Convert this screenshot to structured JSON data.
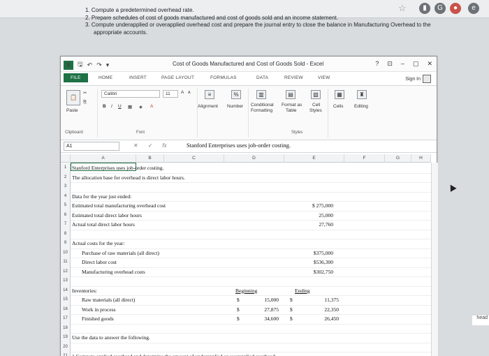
{
  "instructions": [
    "1. Compute a predetermined overhead rate.",
    "2. Prepare schedules of cost of goods manufactured and cost of goods sold and an income statement.",
    "3. Compute underapplied or overapplied overhead cost and prepare the journal entry to close the balance in Manufacturing Overhead to the",
    "appropriate accounts."
  ],
  "window": {
    "title": "Cost of Goods Manufactured and Cost of Goods Sold - Excel",
    "controls": [
      "?",
      "⊡",
      "–",
      "▢",
      "✕"
    ]
  },
  "tabs": [
    "FILE",
    "HOME",
    "INSERT",
    "PAGE LAYOUT",
    "FORMULAS",
    "DATA",
    "REVIEW",
    "VIEW"
  ],
  "sign_in": "Sign In",
  "ribbon": {
    "paste": "Paste",
    "font_name": "Calibri",
    "font_size": "11",
    "grow": "A",
    "shrink": "A",
    "bold": "B",
    "italic": "I",
    "underline": "U",
    "alignment": "Alignment",
    "number": "Number",
    "percent": "%",
    "conditional": "Conditional",
    "formatting": "Formatting",
    "format_as": "Format as",
    "table": "Table",
    "cell": "Cell",
    "styles_btn": "Styles",
    "cells": "Cells",
    "editing": "Editing",
    "group_clipboard": "Clipboard",
    "group_font": "Font",
    "group_styles": "Styles"
  },
  "formula_bar": {
    "name_box": "A1",
    "fx": "fx",
    "content": "Stanford Enterprises uses job-order costing."
  },
  "columns": [
    "A",
    "B",
    "C",
    "D",
    "E",
    "F",
    "G",
    "H"
  ],
  "rows": [
    {
      "n": "1",
      "a": "Stanford Enterprises uses job-order costing."
    },
    {
      "n": "2",
      "a": "The allocation base for overhead is direct labor hours."
    },
    {
      "n": "3",
      "a": ""
    },
    {
      "n": "4",
      "a": "Data for the year just ended:"
    },
    {
      "n": "5",
      "a": "Estimated total manufacturing overhead cost",
      "e": "$  275,000"
    },
    {
      "n": "6",
      "a": "Estimated total direct labor hours",
      "e": "25,000"
    },
    {
      "n": "7",
      "a": "Actual total direct labor hours",
      "e": "27,760"
    },
    {
      "n": "8",
      "a": ""
    },
    {
      "n": "9",
      "a": "Actual costs for the year:"
    },
    {
      "n": "10",
      "b": "Purchase of raw materials (all direct)",
      "e": "$375,000"
    },
    {
      "n": "11",
      "b": "Direct labor cost",
      "e": "$536,300"
    },
    {
      "n": "12",
      "b": "Manufacturing overhead costs",
      "e": "$302,750"
    },
    {
      "n": "13",
      "a": ""
    },
    {
      "n": "14",
      "a": "Inventories:",
      "d": "Beginning",
      "f": "Ending"
    },
    {
      "n": "15",
      "b": "Raw materials (all direct)",
      "ds": "$",
      "dv": "15,000",
      "es": "$",
      "ev": "11,375"
    },
    {
      "n": "16",
      "b": "Work in process",
      "ds": "$",
      "dv": "27,875",
      "es": "$",
      "ev": "22,350"
    },
    {
      "n": "17",
      "b": "Finished goods",
      "ds": "$",
      "dv": "34,600",
      "es": "$",
      "ev": "26,450"
    },
    {
      "n": "18",
      "a": ""
    },
    {
      "n": "19",
      "a": "Use the data to answer the following."
    },
    {
      "n": "20",
      "a": ""
    },
    {
      "n": "21",
      "a": "1  Compute applied overhead and determine the amount of underapplied or overapplied overhead:"
    }
  ],
  "side_clip": "head"
}
